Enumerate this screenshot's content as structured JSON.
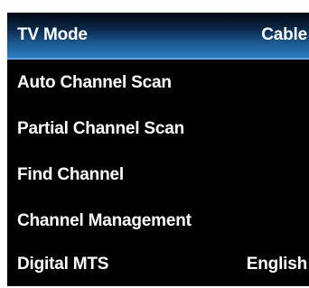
{
  "menu": {
    "items": [
      {
        "label": "TV Mode",
        "value": "Cable",
        "selected": true
      },
      {
        "label": "Auto Channel Scan",
        "value": ""
      },
      {
        "label": "Partial Channel Scan",
        "value": ""
      },
      {
        "label": "Find Channel",
        "value": ""
      },
      {
        "label": "Channel Management",
        "value": ""
      },
      {
        "label": "Digital MTS",
        "value": "English"
      }
    ]
  },
  "colors": {
    "background": "#000000",
    "text": "#ffffff",
    "highlight_top": "#02070f",
    "highlight_bottom": "#2e7cc0",
    "highlight_edge": "#5aa6e6"
  }
}
